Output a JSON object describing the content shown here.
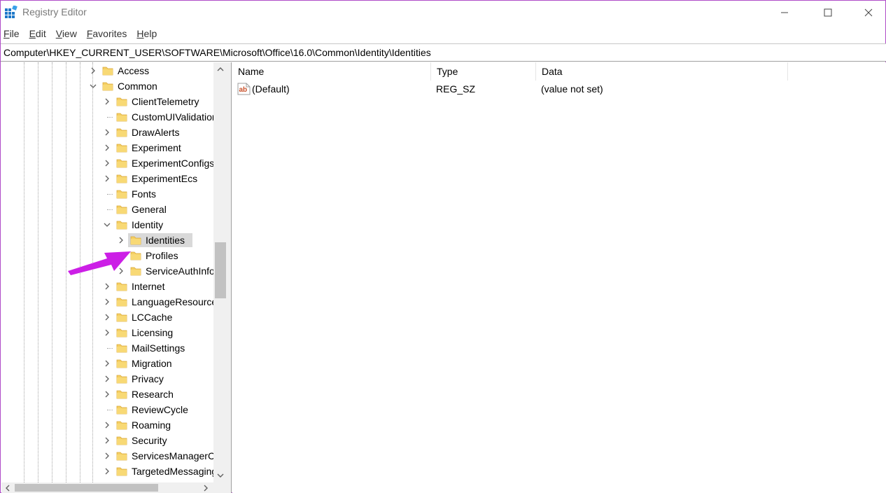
{
  "window": {
    "title": "Registry Editor",
    "controls": {
      "minimize": "minimize",
      "maximize": "maximize",
      "close": "close"
    }
  },
  "menu": [
    {
      "key": "F",
      "rest": "ile"
    },
    {
      "key": "E",
      "rest": "dit"
    },
    {
      "key": "V",
      "rest": "iew"
    },
    {
      "key": "F",
      "rest": "avorites"
    },
    {
      "key": "H",
      "rest": "elp"
    }
  ],
  "address": {
    "path": "Computer\\HKEY_CURRENT_USER\\SOFTWARE\\Microsoft\\Office\\16.0\\Common\\Identity\\Identities"
  },
  "tree": {
    "items": [
      {
        "label": "Access",
        "level": 0,
        "state": "collapsed"
      },
      {
        "label": "Common",
        "level": 0,
        "state": "expanded"
      },
      {
        "label": "ClientTelemetry",
        "level": 1,
        "state": "collapsed"
      },
      {
        "label": "CustomUIValidationCache",
        "level": 1,
        "state": "leaf"
      },
      {
        "label": "DrawAlerts",
        "level": 1,
        "state": "collapsed"
      },
      {
        "label": "Experiment",
        "level": 1,
        "state": "collapsed"
      },
      {
        "label": "ExperimentConfigs",
        "level": 1,
        "state": "collapsed"
      },
      {
        "label": "ExperimentEcs",
        "level": 1,
        "state": "collapsed"
      },
      {
        "label": "Fonts",
        "level": 1,
        "state": "leaf"
      },
      {
        "label": "General",
        "level": 1,
        "state": "leaf"
      },
      {
        "label": "Identity",
        "level": 1,
        "state": "expanded"
      },
      {
        "label": "Identities",
        "level": 2,
        "state": "collapsed",
        "selected": true
      },
      {
        "label": "Profiles",
        "level": 2,
        "state": "leaf"
      },
      {
        "label": "ServiceAuthInfo",
        "level": 2,
        "state": "collapsed"
      },
      {
        "label": "Internet",
        "level": 1,
        "state": "collapsed"
      },
      {
        "label": "LanguageResources",
        "level": 1,
        "state": "collapsed"
      },
      {
        "label": "LCCache",
        "level": 1,
        "state": "collapsed"
      },
      {
        "label": "Licensing",
        "level": 1,
        "state": "collapsed"
      },
      {
        "label": "MailSettings",
        "level": 1,
        "state": "leaf"
      },
      {
        "label": "Migration",
        "level": 1,
        "state": "collapsed"
      },
      {
        "label": "Privacy",
        "level": 1,
        "state": "collapsed"
      },
      {
        "label": "Research",
        "level": 1,
        "state": "collapsed"
      },
      {
        "label": "ReviewCycle",
        "level": 1,
        "state": "leaf"
      },
      {
        "label": "Roaming",
        "level": 1,
        "state": "collapsed"
      },
      {
        "label": "Security",
        "level": 1,
        "state": "collapsed"
      },
      {
        "label": "ServicesManagerCache",
        "level": 1,
        "state": "collapsed"
      },
      {
        "label": "TargetedMessagingService",
        "level": 1,
        "state": "collapsed"
      }
    ]
  },
  "values": {
    "columns": [
      "Name",
      "Type",
      "Data"
    ],
    "rows": [
      {
        "name": "(Default)",
        "type": "REG_SZ",
        "data": "(value not set)",
        "icon": "string-value-icon"
      }
    ]
  },
  "colors": {
    "window_border": "#b04cc8",
    "annotation_arrow": "#cc1fe6",
    "folder": "#f5cf63",
    "selection": "#d9d9d9"
  }
}
